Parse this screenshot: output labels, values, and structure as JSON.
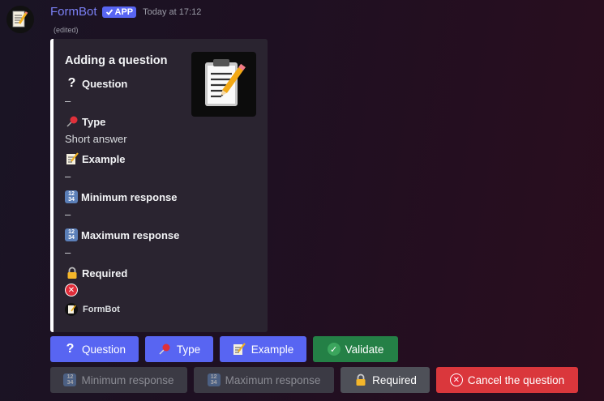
{
  "message": {
    "username": "FormBot",
    "badge": "APP",
    "timestamp": "Today at 17:12",
    "edited": "(edited)",
    "avatar_icon": "memo-icon"
  },
  "embed": {
    "title": "Adding a question",
    "thumbnail_icon": "clipboard-pencil-icon",
    "fields": [
      {
        "name": "Question",
        "icon": "question-icon",
        "value": "–"
      },
      {
        "name": "Type",
        "icon": "pushpin-icon",
        "value": "Short answer"
      },
      {
        "name": "Example",
        "icon": "memo-icon",
        "value": "–"
      },
      {
        "name": "Minimum response",
        "icon": "numbers-icon",
        "value": "–"
      },
      {
        "name": "Maximum response",
        "icon": "numbers-icon",
        "value": "–"
      },
      {
        "name": "Required",
        "icon": "lock-icon",
        "value_icon": "cross-mark-icon"
      }
    ],
    "footer": "FormBot",
    "accent": "#ffffff"
  },
  "buttons_row1": [
    {
      "label": "Question",
      "style": "primary",
      "icon": "question-icon"
    },
    {
      "label": "Type",
      "style": "primary",
      "icon": "pushpin-icon"
    },
    {
      "label": "Example",
      "style": "primary",
      "icon": "memo-icon"
    },
    {
      "label": "Validate",
      "style": "success",
      "icon": "check-icon"
    }
  ],
  "buttons_row2": [
    {
      "label": "Minimum response",
      "style": "disabled",
      "icon": "numbers-icon"
    },
    {
      "label": "Maximum response",
      "style": "disabled",
      "icon": "numbers-icon"
    },
    {
      "label": "Required",
      "style": "secondary",
      "icon": "lock-icon"
    },
    {
      "label": "Cancel the question",
      "style": "danger",
      "icon": "cross-mark-icon"
    }
  ],
  "colors": {
    "primary": "#5865f2",
    "success": "#248046",
    "secondary": "#4e5058",
    "danger": "#da373c",
    "username": "#7b80f5"
  }
}
